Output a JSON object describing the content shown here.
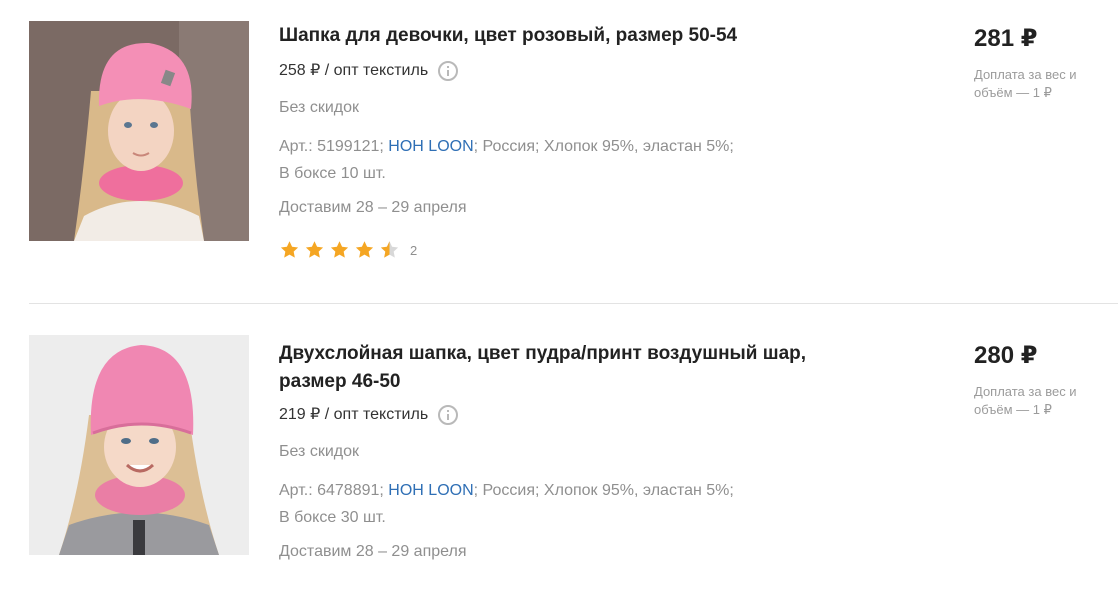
{
  "products": [
    {
      "title": "Шапка для девочки, цвет розовый, размер 50-54",
      "opt_price": "258 ₽ / опт текстиль",
      "discount": "Без скидок",
      "art_prefix": "Арт.: 5199121; ",
      "brand": "HOH LOON",
      "art_suffix": "; Россия; Хлопок 95%, эластан 5%;",
      "box": "В боксе 10 шт.",
      "delivery": "Доставим 28 – 29 апреля",
      "rating": 4.5,
      "reviews": "2",
      "price": "281 ₽",
      "surcharge": "Доплата за вес и объём — 1 ₽",
      "image": "girl-pink-hat-photo"
    },
    {
      "title": "Двухслойная шапка, цвет пудра/принт воздушный шар, размер 46-50",
      "opt_price": "219 ₽ / опт текстиль",
      "discount": "Без скидок",
      "art_prefix": "Арт.: 6478891; ",
      "brand": "HOH LOON",
      "art_suffix": "; Россия; Хлопок 95%, эластан 5%;",
      "box": "В боксе 30 шт.",
      "delivery": "Доставим 28 – 29 апреля",
      "price": "280 ₽",
      "surcharge": "Доплата за вес и объём — 1 ₽",
      "image": "girl-pink-beanie-photo"
    }
  ],
  "colors": {
    "brand_link": "#2f6fb5",
    "star": "#f5a623",
    "muted_text": "#8f8f8f"
  }
}
